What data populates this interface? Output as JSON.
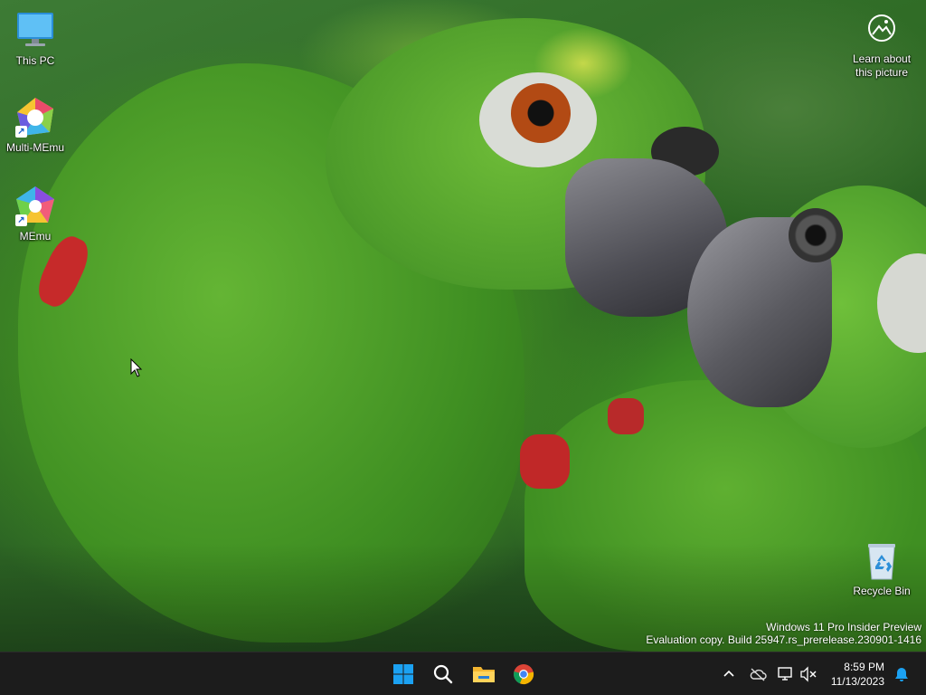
{
  "desktop": {
    "icons": [
      {
        "label": "This PC"
      },
      {
        "label": "Multi-MEmu"
      },
      {
        "label": "MEmu"
      },
      {
        "label": "Recycle Bin"
      }
    ],
    "learn_about_picture": {
      "line1": "Learn about",
      "line2": "this picture"
    },
    "watermark": {
      "line1": "Windows 11 Pro Insider Preview",
      "line2": "Evaluation copy. Build 25947.rs_prerelease.230901-1416"
    }
  },
  "taskbar": {
    "pinned": [
      {
        "name": "start-button",
        "icon": "windows-logo-icon"
      },
      {
        "name": "search-button",
        "icon": "search-icon"
      },
      {
        "name": "file-explorer-button",
        "icon": "folder-icon"
      },
      {
        "name": "chrome-button",
        "icon": "chrome-icon"
      }
    ],
    "tray": {
      "icons": [
        "chevron-up-icon",
        "cloud-offline-icon",
        "network-icon",
        "volume-muted-icon"
      ],
      "time": "8:59 PM",
      "date": "11/13/2023"
    },
    "colors": {
      "background": "#1c1c1c",
      "accent": "#0078d4"
    }
  }
}
